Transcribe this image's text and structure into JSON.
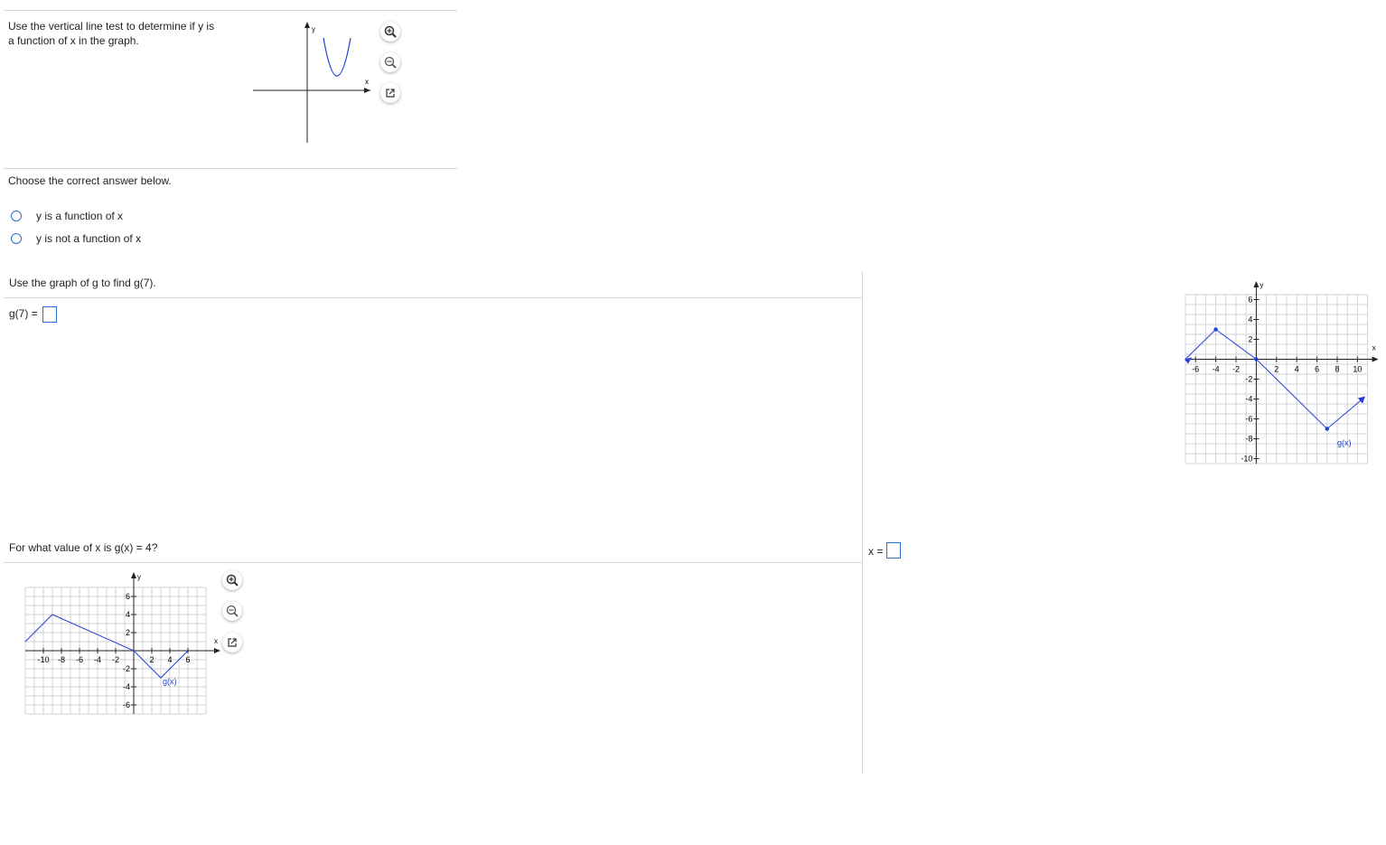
{
  "q1": {
    "prompt_line1": "Use the vertical line test to determine if y is",
    "prompt_line2": "a function of x in the graph.",
    "graph": {
      "y_label": "y",
      "x_label": "x"
    },
    "instruction": "Choose the correct answer below.",
    "options": [
      {
        "label": "y is a function of x"
      },
      {
        "label": "y is not a function of x"
      }
    ]
  },
  "q2": {
    "prompt": "Use the graph of g to find g(7).",
    "answer_label": "g(7) ="
  },
  "q3": {
    "prompt": "For what value of x is g(x) = 4?",
    "answer_label": "x ="
  },
  "graph_small": {
    "func_label": "g(x)",
    "y_label": "y",
    "x_label": "x",
    "x_ticks": [
      "-10",
      "-8",
      "-6",
      "-4",
      "-2",
      "2",
      "4",
      "6"
    ],
    "y_ticks": [
      "6",
      "4",
      "2",
      "-2",
      "-4",
      "-6"
    ]
  },
  "graph_right": {
    "func_label": "g(x)",
    "y_label": "y",
    "x_label": "x",
    "x_ticks": [
      "-6",
      "-4",
      "-2",
      "2",
      "4",
      "6",
      "8",
      "10"
    ],
    "y_ticks": [
      "6",
      "4",
      "2",
      "-2",
      "-4",
      "-6",
      "-8",
      "-10"
    ]
  },
  "icons": [
    "zoom-in-icon",
    "zoom-out-icon",
    "popout-icon"
  ],
  "colors": {
    "curve": "#1f3fd6",
    "radio": "#2a6ecf",
    "grid": "#cfcfcf"
  }
}
